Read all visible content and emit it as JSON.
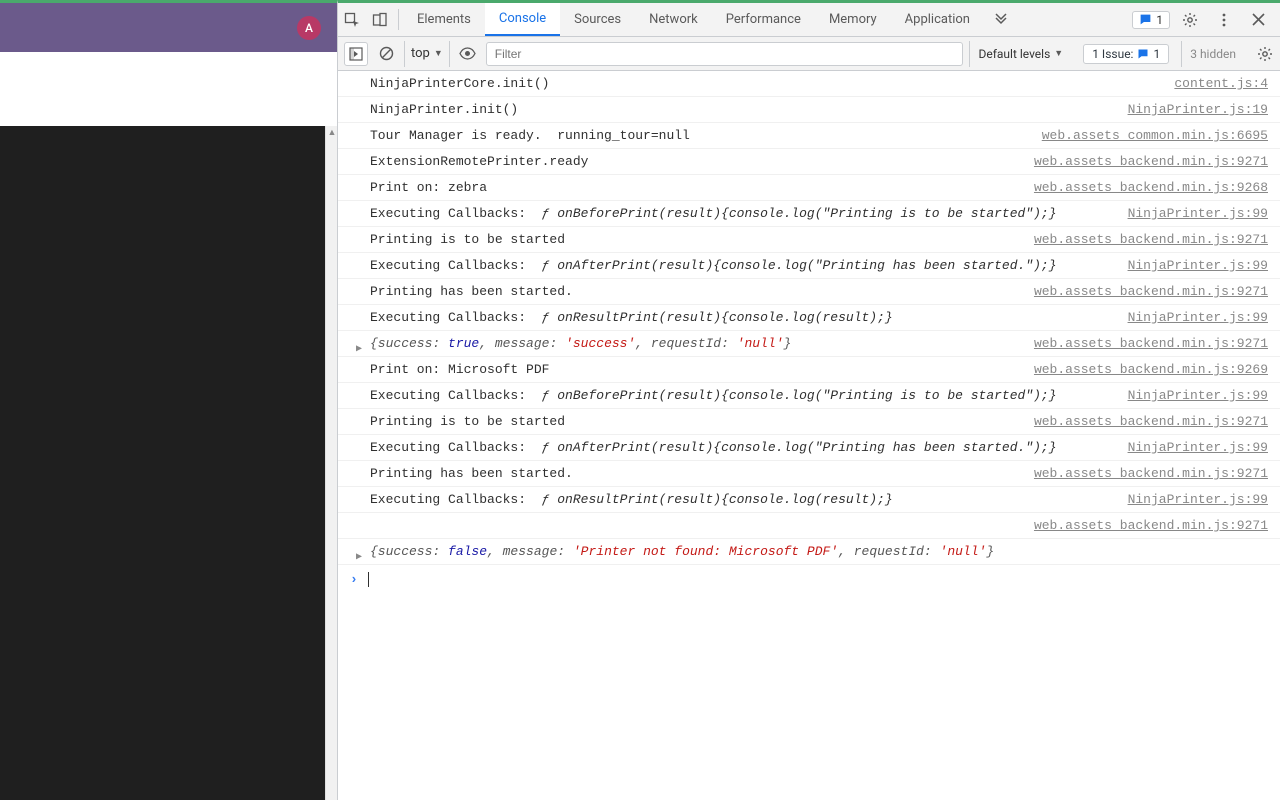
{
  "avatar": {
    "letter": "A"
  },
  "tabs": {
    "elements": "Elements",
    "console": "Console",
    "sources": "Sources",
    "network": "Network",
    "performance": "Performance",
    "memory": "Memory",
    "application": "Application"
  },
  "top_chip_count": "1",
  "toolbar": {
    "context": "top",
    "filter_placeholder": "Filter",
    "levels": "Default levels",
    "issues_label": "1 Issue:",
    "issues_count": "1",
    "hidden": "3 hidden"
  },
  "logs": [
    {
      "msg": "NinjaPrinterCore.init()",
      "src": "content.js:4"
    },
    {
      "msg": "NinjaPrinter.init()",
      "src": "NinjaPrinter.js:19"
    },
    {
      "msg": "Tour Manager is ready.  running_tour=null",
      "src": "web.assets_common.min.js:6695"
    },
    {
      "msg": "ExtensionRemotePrinter.ready",
      "src": "web.assets_backend.min.js:9271"
    },
    {
      "msg": "Print on: zebra",
      "src": "web.assets_backend.min.js:9268"
    },
    {
      "type": "cb",
      "label": "Executing Callbacks:  ",
      "fn": "onBeforePrint(result){console.log(\"Printing is to be started\");}",
      "src": "NinjaPrinter.js:99"
    },
    {
      "msg": "Printing is to be started",
      "src": "web.assets_backend.min.js:9271"
    },
    {
      "type": "cb",
      "label": "Executing Callbacks:  ",
      "fn": "onAfterPrint(result){console.log(\"Printing has been started.\");}",
      "src": "NinjaPrinter.js:99"
    },
    {
      "msg": "Printing has been started.",
      "src": "web.assets_backend.min.js:9271"
    },
    {
      "type": "cb",
      "label": "Executing Callbacks:  ",
      "fn": "onResultPrint(result){console.log(result);}",
      "src": "NinjaPrinter.js:99"
    },
    {
      "type": "obj",
      "success": "true",
      "message": "'success'",
      "requestId": "'null'",
      "src": "web.assets_backend.min.js:9271"
    },
    {
      "msg": "Print on: Microsoft PDF",
      "src": "web.assets_backend.min.js:9269"
    },
    {
      "type": "cb",
      "label": "Executing Callbacks:  ",
      "fn": "onBeforePrint(result){console.log(\"Printing is to be started\");}",
      "src": "NinjaPrinter.js:99"
    },
    {
      "msg": "Printing is to be started",
      "src": "web.assets_backend.min.js:9271"
    },
    {
      "type": "cb",
      "label": "Executing Callbacks:  ",
      "fn": "onAfterPrint(result){console.log(\"Printing has been started.\");}",
      "src": "NinjaPrinter.js:99"
    },
    {
      "msg": "Printing has been started.",
      "src": "web.assets_backend.min.js:9271"
    },
    {
      "type": "cb",
      "label": "Executing Callbacks:  ",
      "fn": "onResultPrint(result){console.log(result);}",
      "src": "NinjaPrinter.js:99"
    },
    {
      "type": "srcOnly",
      "src": "web.assets_backend.min.js:9271"
    },
    {
      "type": "obj",
      "success": "false",
      "message": "'Printer not found: Microsoft PDF'",
      "requestId": "'null'",
      "src": ""
    }
  ]
}
